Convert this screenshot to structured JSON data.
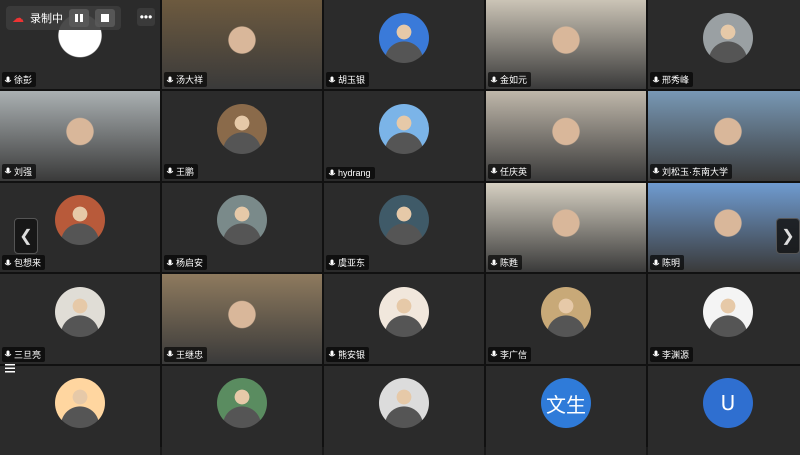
{
  "recording": {
    "label": "录制中"
  },
  "colors": {
    "active_border": "#23c15a",
    "bg": "#1a1a1a",
    "tile": "#2b2b2b"
  },
  "participants": [
    {
      "name": "徐彭",
      "kind": "photo",
      "color": "#f2f2f2"
    },
    {
      "name": "汤大祥",
      "kind": "video",
      "color": "#6d5a3f"
    },
    {
      "name": "胡玉银",
      "kind": "avatar",
      "color": "#3a7ad9"
    },
    {
      "name": "金如元",
      "kind": "video",
      "color": "#cbc4b6"
    },
    {
      "name": "邢秀峰",
      "kind": "avatar",
      "color": "#9aa0a3"
    },
    {
      "name": "刘强",
      "kind": "video",
      "color": "#aab0b2"
    },
    {
      "name": "王鹏",
      "kind": "avatar",
      "color": "#8a6a4a"
    },
    {
      "name": "hydrang",
      "kind": "avatar",
      "color": "#7bb4e8"
    },
    {
      "name": "任庆英",
      "kind": "video",
      "color": "#bfb7aa"
    },
    {
      "name": "刘松玉·东南大学",
      "kind": "video",
      "color": "#7898b5"
    },
    {
      "name": "包想来",
      "kind": "avatar",
      "color": "#b85a3a"
    },
    {
      "name": "杨启安",
      "kind": "avatar",
      "color": "#7a8a8a"
    },
    {
      "name": "虞亚东",
      "kind": "avatar",
      "color": "#3f5a68"
    },
    {
      "name": "陈甦",
      "kind": "video",
      "color": "#d6d0c2",
      "active": true
    },
    {
      "name": "陈明",
      "kind": "video",
      "color": "#6f9bd0"
    },
    {
      "name": "三旦亮",
      "kind": "avatar",
      "color": "#e0ddd6"
    },
    {
      "name": "王继忠",
      "kind": "video",
      "color": "#8e7a5e"
    },
    {
      "name": "熊安银",
      "kind": "avatar",
      "color": "#f1e7dc"
    },
    {
      "name": "李广信",
      "kind": "avatar",
      "color": "#c8a978"
    },
    {
      "name": "李渊源",
      "kind": "avatar",
      "color": "#f4f4f4"
    },
    {
      "name": "",
      "kind": "avatar",
      "color": "#ffd6a0"
    },
    {
      "name": "",
      "kind": "avatar",
      "color": "#5a8c60"
    },
    {
      "name": "",
      "kind": "avatar",
      "color": "#dcdcdc"
    },
    {
      "name": "",
      "kind": "letter",
      "color": "#2f7bd9",
      "letter": "文生"
    },
    {
      "name": "",
      "kind": "letter",
      "color": "#2f6fd0",
      "letter": "U"
    }
  ]
}
